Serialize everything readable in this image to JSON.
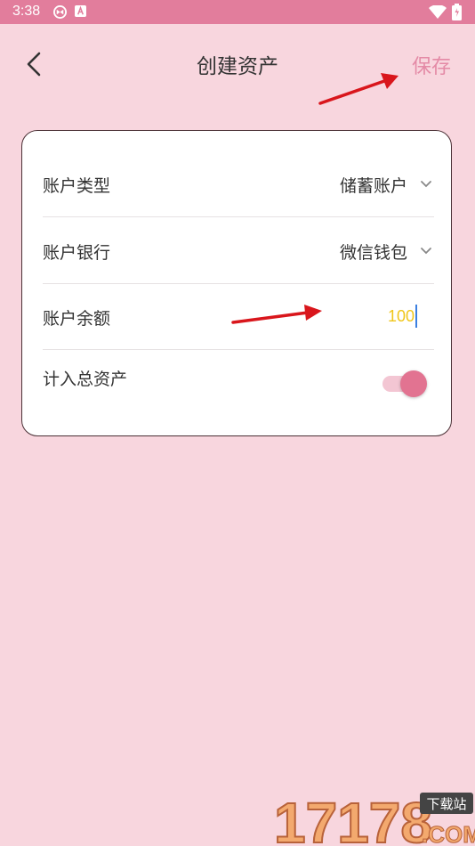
{
  "status_bar": {
    "time": "3:38"
  },
  "header": {
    "title": "创建资产",
    "save_label": "保存"
  },
  "form": {
    "account_type": {
      "label": "账户类型",
      "value": "储蓄账户"
    },
    "account_bank": {
      "label": "账户银行",
      "value": "微信钱包"
    },
    "account_balance": {
      "label": "账户余额",
      "value": "100"
    },
    "include_total": {
      "label": "计入总资产",
      "checked": true
    }
  },
  "watermark": {
    "number": "17178",
    "tag": "下载站",
    "domain": ".COM"
  },
  "colors": {
    "status_bar": "#e27d9c",
    "background": "#f8d6de",
    "accent": "#e48aa6",
    "amount": "#f0c61a",
    "toggle_on": "#e27391"
  }
}
